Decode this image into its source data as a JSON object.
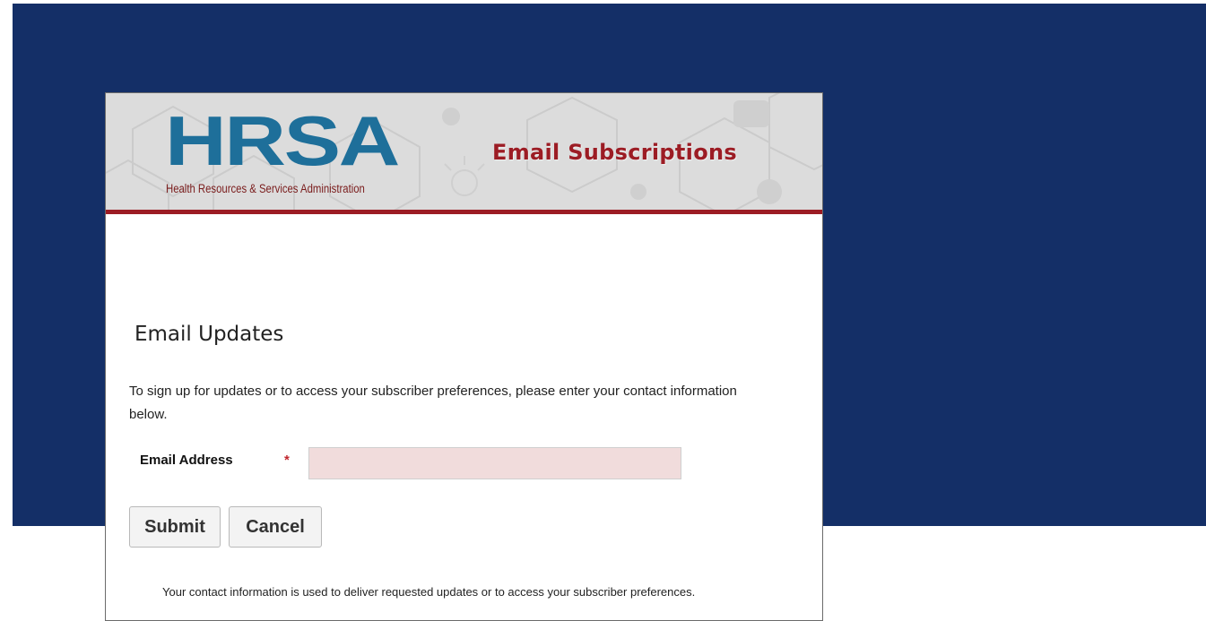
{
  "header": {
    "logo_text": "HRSA",
    "logo_tagline": "Health Resources & Services Administration",
    "title": "Email Subscriptions"
  },
  "main": {
    "heading": "Email Updates",
    "intro": "To sign up for updates or to access your subscriber preferences, please enter your contact information below.",
    "email_label": "Email Address",
    "required_mark": "*",
    "email_value": "",
    "submit_label": "Submit",
    "cancel_label": "Cancel",
    "footnote": "Your contact information is used to deliver requested updates or to access your subscriber preferences."
  },
  "colors": {
    "page_band": "#142f67",
    "brand_blue": "#1e6f9a",
    "brand_red": "#9c1c24",
    "input_bg": "#f1dcdc"
  }
}
